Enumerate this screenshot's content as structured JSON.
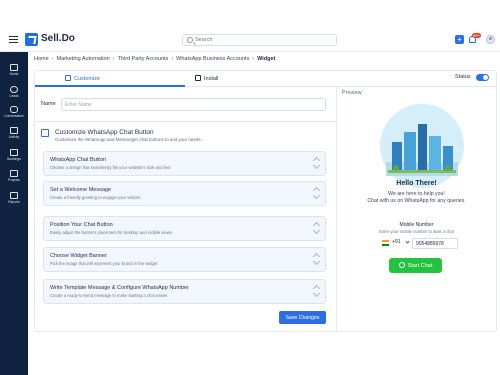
{
  "app": {
    "name": "Sell.Do"
  },
  "search": {
    "placeholder": "Search"
  },
  "header": {
    "notification_count": "99+"
  },
  "sidebar": {
    "items": [
      {
        "label": "Home"
      },
      {
        "label": "Leads"
      },
      {
        "label": "Conversation"
      },
      {
        "label": "Activity"
      },
      {
        "label": "Bookings"
      },
      {
        "label": "Projects"
      },
      {
        "label": "Reports"
      }
    ]
  },
  "breadcrumb": [
    "Home",
    "Marketing Automation",
    "Third Party Accounts",
    "WhatsApp Business Accounts",
    "Widget"
  ],
  "tabs": {
    "customize": "Customize",
    "install": "Install"
  },
  "status": {
    "label": "Status",
    "enabled": true
  },
  "form": {
    "name_label": "Name",
    "name_placeholder": "Enter Name",
    "section_title": "Customize WhatsApp Chat Button",
    "section_subtitle": "Customize the WhatsApp and Messenger chat buttons to suit your needs.",
    "accordions": [
      {
        "title": "WhatsApp Chat Button",
        "desc": "Choose a design that seamlessly fits your website's look and feel"
      },
      {
        "title": "Set a Welcome Message",
        "desc": "Create a friendly greeting to engage your visitors"
      },
      {
        "title": "Position Your Chat Button",
        "desc": "Easily adjust the button's placement for desktop and mobile views"
      },
      {
        "title": "Choose Widget Banner",
        "desc": "Pick the image that will represent your brand in the widget"
      },
      {
        "title": "Write Template Message & Configure WhatsApp Number",
        "desc": "Create a ready-to-send message to make starting a chat easier"
      }
    ],
    "save_label": "Save Changes"
  },
  "preview": {
    "label": "Preview",
    "hello": "Hello There!",
    "help_line1": "We are here to help you!",
    "help_line2": "Chat with us on WhatsApp for any queries.",
    "mobile_label": "Mobile Number",
    "mobile_hint": "Enter your mobile number to start a chat",
    "dial_code": "+91",
    "phone_value": "9054889978",
    "chat_button": "Start Chat"
  },
  "colors": {
    "primary": "#2c6fe0",
    "sidebar": "#0f2340",
    "whatsapp": "#25c23f"
  }
}
